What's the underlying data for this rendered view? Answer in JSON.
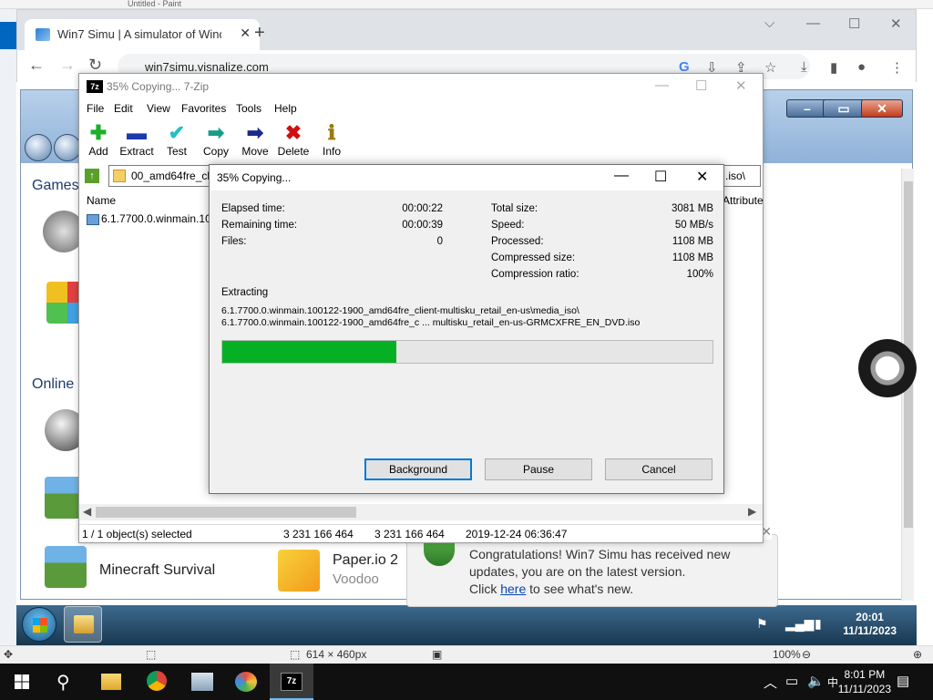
{
  "host": {
    "top_text": "Untitled - Paint",
    "status_size": "614 × 460px",
    "zoom": "100%"
  },
  "browser": {
    "tab_title": "Win7 Simu | A simulator of Wind",
    "url": "win7simu.visnalize.com"
  },
  "simu": {
    "section_games": "Games",
    "section_online": "Online",
    "games": [
      {
        "title": "Minecraft Survival",
        "sub": ""
      },
      {
        "title": "Paper.io 2",
        "sub": "Voodoo"
      }
    ],
    "notification": {
      "line1": "Congratulations! Win7 Simu has received new",
      "line2": "updates, you are on the latest version.",
      "line3_pre": "Click ",
      "link": "here",
      "line3_post": " to see what's new."
    },
    "clock_time": "20:01",
    "clock_date": "11/11/2023"
  },
  "zip": {
    "title": "35% Copying... 7-Zip",
    "menu": [
      "File",
      "Edit",
      "View",
      "Favorites",
      "Tools",
      "Help"
    ],
    "tools": [
      "Add",
      "Extract",
      "Test",
      "Copy",
      "Move",
      "Delete",
      "Info"
    ],
    "address_start": "00_amd64fre_clie",
    "address_end": ".iso\\",
    "col_name": "Name",
    "col_attr": "Attribute",
    "row_name": "6.1.7700.0.winmain.100",
    "status": {
      "selected": "1 / 1 object(s) selected",
      "size1": "3 231 166 464",
      "size2": "3 231 166 464",
      "date": "2019-12-24 06:36:47"
    }
  },
  "dialog": {
    "title": "35% Copying...",
    "elapsed_label": "Elapsed time:",
    "elapsed": "00:00:22",
    "remaining_label": "Remaining time:",
    "remaining": "00:00:39",
    "files_label": "Files:",
    "files": "0",
    "total_label": "Total size:",
    "total": "3081 MB",
    "speed_label": "Speed:",
    "speed": "50 MB/s",
    "processed_label": "Processed:",
    "processed": "1108 MB",
    "compressed_label": "Compressed size:",
    "compressed": "1108 MB",
    "ratio_label": "Compression ratio:",
    "ratio": "100%",
    "op": "Extracting",
    "path1": "6.1.7700.0.winmain.100122-1900_amd64fre_client-multisku_retail_en-us\\media_iso\\",
    "path2": "6.1.7700.0.winmain.100122-1900_amd64fre_c ... multisku_retail_en-us-GRMCXFRE_EN_DVD.iso",
    "progress": 0.355,
    "btn_background": "Background",
    "btn_pause": "Pause",
    "btn_cancel": "Cancel"
  },
  "taskbar": {
    "time": "8:01 PM",
    "date": "11/11/2023"
  },
  "colors": {
    "progress_fill": "#06b025",
    "accent": "#0078d7"
  }
}
